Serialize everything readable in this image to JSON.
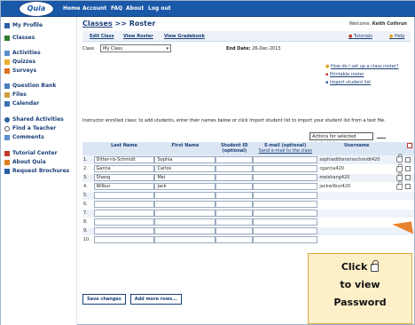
{
  "nav": {
    "logo": "Quia",
    "items": [
      "Home",
      "Account",
      "FAQ",
      "About",
      "Log out"
    ]
  },
  "sidebar": {
    "items": [
      {
        "label": "My Profile",
        "icon": "profile-icon"
      },
      {
        "label": "Classes",
        "icon": "classes-icon"
      },
      {
        "label": "Activities",
        "icon": "activities-icon"
      },
      {
        "label": "Quizzes",
        "icon": "quizzes-icon"
      },
      {
        "label": "Surveys",
        "icon": "surveys-icon"
      },
      {
        "label": "Question Bank",
        "icon": "question-bank-icon"
      },
      {
        "label": "Files",
        "icon": "files-icon"
      },
      {
        "label": "Calendar",
        "icon": "calendar-icon"
      },
      {
        "label": "Shared Activities",
        "icon": "shared-icon"
      },
      {
        "label": "Find a Teacher",
        "icon": "find-teacher-icon"
      },
      {
        "label": "Comments",
        "icon": "comments-icon"
      },
      {
        "label": "Tutorial Center",
        "icon": "tutorial-icon"
      },
      {
        "label": "About Quia",
        "icon": "about-icon"
      },
      {
        "label": "Request Brochures",
        "icon": "brochure-icon"
      }
    ]
  },
  "header": {
    "breadcrumb_link": "Classes",
    "breadcrumb_sep": " >> ",
    "breadcrumb_current": "Roster",
    "welcome_prefix": "Welcome, ",
    "welcome_name": "Keith Cothrun"
  },
  "tabs": [
    "Edit Class",
    "View Roster",
    "View Gradebook"
  ],
  "tutorials": "Tutorials",
  "help": "Help",
  "class_label": "Class",
  "class_value": "My Class",
  "end_date_label": "End Date:",
  "end_date_value": "26-Dec-2013",
  "help_links": [
    "How do I set up a class roster?",
    "Printable roster",
    "Import student list"
  ],
  "instructions": "Instructor enrolled class: to add students, enter their names below or click Import student list to import your student list from a text file.",
  "actions_select": "Actions for selected student(s)",
  "table": {
    "headers": [
      "Last Name",
      "First Name",
      "Student ID (optional)",
      "E-mail (optional)",
      "Username"
    ],
    "send_email": "Send e-mail to the class",
    "rows": [
      {
        "n": "1.",
        "last": "Ditter-ris-Schmidt",
        "first": "Sophia",
        "id": "",
        "email": "",
        "user": "sophiadittersrisschmidt420"
      },
      {
        "n": "2.",
        "last": "Garcia",
        "first": "Carlos",
        "id": "",
        "email": "",
        "user": "cgarcia420"
      },
      {
        "n": "3.",
        "last": "Shang",
        "first": "Mei",
        "id": "",
        "email": "",
        "user": "meishang420"
      },
      {
        "n": "4.",
        "last": "Wilbur",
        "first": "Jack",
        "id": "",
        "email": "",
        "user": "jackwilbur420"
      },
      {
        "n": "5.",
        "last": "",
        "first": "",
        "id": "",
        "email": "",
        "user": ""
      },
      {
        "n": "6.",
        "last": "",
        "first": "",
        "id": "",
        "email": "",
        "user": ""
      },
      {
        "n": "7.",
        "last": "",
        "first": "",
        "id": "",
        "email": "",
        "user": ""
      },
      {
        "n": "8.",
        "last": "",
        "first": "",
        "id": "",
        "email": "",
        "user": ""
      },
      {
        "n": "9.",
        "last": "",
        "first": "",
        "id": "",
        "email": "",
        "user": ""
      },
      {
        "n": "10.",
        "last": "",
        "first": "",
        "id": "",
        "email": "",
        "user": ""
      }
    ]
  },
  "buttons": {
    "save": "Save changes",
    "add_rows": "Add more rows..."
  },
  "callout": {
    "line1": "Click",
    "line2": "to view",
    "line3": "Password"
  },
  "colors": {
    "nav_bg": "#1a58a8",
    "callout_bg": "#fdf0c8",
    "callout_arrow": "#e8822f"
  }
}
